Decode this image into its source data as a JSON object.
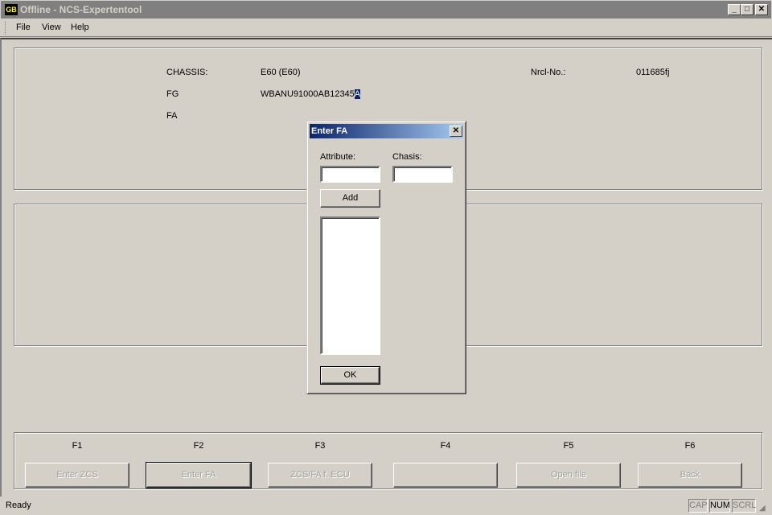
{
  "window": {
    "title": "Offline - NCS-Expertentool",
    "icon": "ncs-app-icon",
    "icon_text": "GB"
  },
  "menu": [
    "File",
    "View",
    "Help"
  ],
  "info": {
    "chassis_label": "CHASSIS:",
    "chassis_value": "E60 (E60)",
    "nrcl_label": "Nrcl-No.:",
    "nrcl_value": "011685fj",
    "fg_label": "FG",
    "fg_value": "WBANU91000AB12345",
    "fg_selected_char": "A",
    "fa_label": "FA"
  },
  "dialog": {
    "title": "Enter FA",
    "attribute_label": "Attribute:",
    "attribute_value": "",
    "chasis_label": "Chasis:",
    "chasis_value": "",
    "add_label": "Add",
    "ok_label": "OK",
    "list_items": []
  },
  "fkeys": [
    {
      "key": "F1",
      "label": "Enter ZCS",
      "enabled": false
    },
    {
      "key": "F2",
      "label": "Enter FA",
      "enabled": false,
      "default": true
    },
    {
      "key": "F3",
      "label": "ZCS/FA f. ECU",
      "enabled": false
    },
    {
      "key": "F4",
      "label": "",
      "enabled": false
    },
    {
      "key": "F5",
      "label": "Open file",
      "enabled": false
    },
    {
      "key": "F6",
      "label": "Back",
      "enabled": false
    }
  ],
  "status": {
    "text": "Ready",
    "indicators": [
      "CAP",
      "NUM",
      "SCRL"
    ],
    "active_indicator": "NUM"
  },
  "colors": {
    "face": "#d4d0c8",
    "title_inactive": "#808080",
    "dialog_title_start": "#0a246a",
    "dialog_title_end": "#a6caf0"
  }
}
